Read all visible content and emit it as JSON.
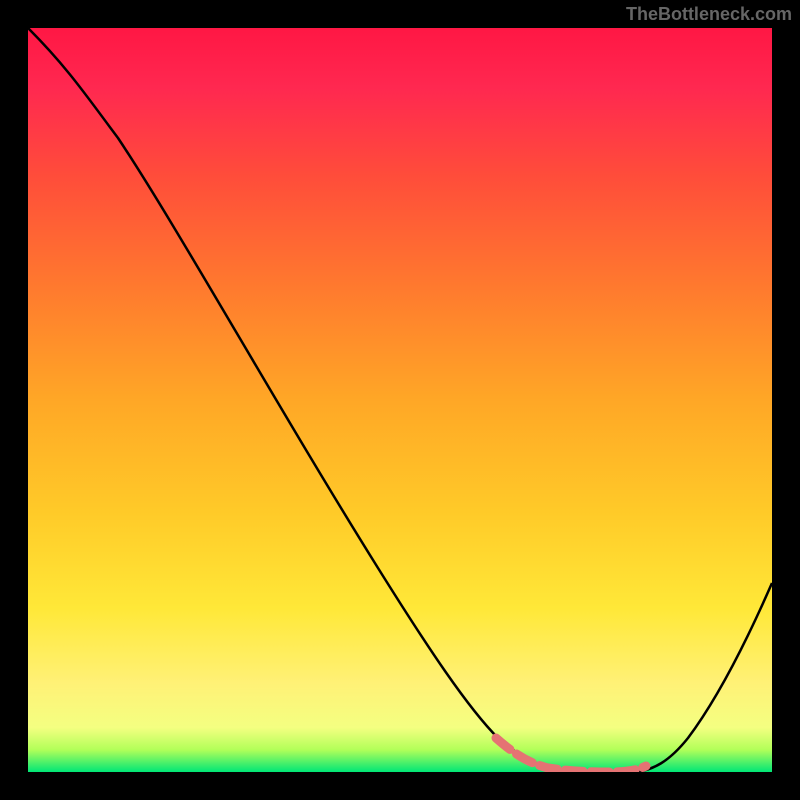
{
  "watermark": "TheBottleneck.com",
  "chart_data": {
    "type": "line",
    "title": "",
    "xlabel": "",
    "ylabel": "",
    "x_range": [
      0,
      100
    ],
    "y_range": [
      0,
      100
    ],
    "gradient_colors": {
      "top": "#ff1744",
      "upper_mid": "#ff5722",
      "mid": "#ffc107",
      "lower_mid": "#ffeb3b",
      "bottom": "#00e676"
    },
    "series": [
      {
        "name": "bottleneck-curve",
        "color": "#000000",
        "x": [
          0,
          5,
          10,
          15,
          20,
          25,
          30,
          35,
          40,
          45,
          50,
          55,
          60,
          63,
          66,
          70,
          75,
          80,
          82,
          85,
          90,
          95,
          100
        ],
        "y": [
          100,
          95,
          88,
          80,
          72,
          64,
          56,
          48,
          40,
          32,
          25,
          18,
          12,
          8,
          5,
          2,
          0,
          0,
          0,
          2,
          10,
          20,
          30
        ]
      },
      {
        "name": "highlight-region",
        "color": "#e57373",
        "type": "marker",
        "x": [
          63,
          66,
          70,
          73,
          76,
          79,
          82
        ],
        "y": [
          5,
          3,
          1,
          0,
          0,
          0,
          1
        ]
      }
    ]
  }
}
